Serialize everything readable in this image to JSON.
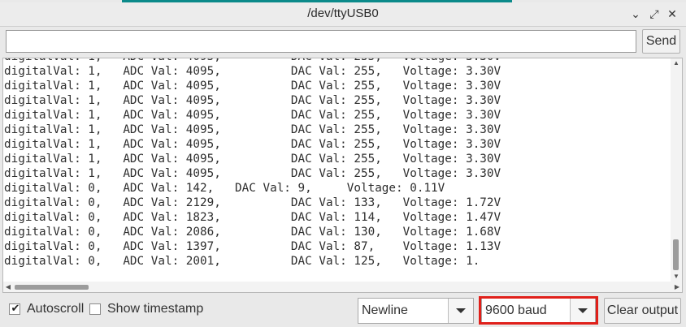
{
  "window": {
    "title": "/dev/ttyUSB0",
    "controls": {
      "collapse_glyph": "⌄",
      "maximize_glyph": "⤢",
      "close_glyph": "✕"
    }
  },
  "send": {
    "input_value": "",
    "button_label": "Send"
  },
  "output": {
    "lines": [
      "digitalVal: 1,   ADC Val: 4095,          DAC Val: 255,   Voltage: 3.30V",
      "digitalVal: 1,   ADC Val: 4095,          DAC Val: 255,   Voltage: 3.30V",
      "digitalVal: 1,   ADC Val: 4095,          DAC Val: 255,   Voltage: 3.30V",
      "digitalVal: 1,   ADC Val: 4095,          DAC Val: 255,   Voltage: 3.30V",
      "digitalVal: 1,   ADC Val: 4095,          DAC Val: 255,   Voltage: 3.30V",
      "digitalVal: 1,   ADC Val: 4095,          DAC Val: 255,   Voltage: 3.30V",
      "digitalVal: 1,   ADC Val: 4095,          DAC Val: 255,   Voltage: 3.30V",
      "digitalVal: 1,   ADC Val: 4095,          DAC Val: 255,   Voltage: 3.30V",
      "digitalVal: 1,   ADC Val: 4095,          DAC Val: 255,   Voltage: 3.30V",
      "digitalVal: 0,   ADC Val: 142,   DAC Val: 9,     Voltage: 0.11V",
      "digitalVal: 0,   ADC Val: 2129,          DAC Val: 133,   Voltage: 1.72V",
      "digitalVal: 0,   ADC Val: 1823,          DAC Val: 114,   Voltage: 1.47V",
      "digitalVal: 0,   ADC Val: 2086,          DAC Val: 130,   Voltage: 1.68V",
      "digitalVal: 0,   ADC Val: 1397,          DAC Val: 87,    Voltage: 1.13V",
      "digitalVal: 0,   ADC Val: 2001,          DAC Val: 125,   Voltage: 1."
    ]
  },
  "footer": {
    "autoscroll": {
      "label": "Autoscroll",
      "checked": true,
      "tick": "✔"
    },
    "timestamp": {
      "label": "Show timestamp",
      "checked": false
    },
    "line_ending": {
      "selected": "Newline"
    },
    "baud": {
      "selected": "9600 baud"
    },
    "clear_label": "Clear output"
  },
  "colors": {
    "highlight": "#e0201a",
    "accent_strip": "#0b8a8a"
  }
}
